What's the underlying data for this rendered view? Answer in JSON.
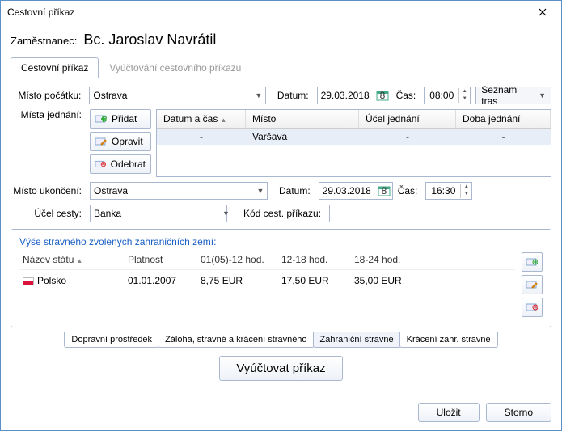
{
  "window": {
    "title": "Cestovní příkaz"
  },
  "employee": {
    "label": "Zaměstnanec:",
    "name": "Bc. Jaroslav Navrátil"
  },
  "tabs": {
    "order": "Cestovní příkaz",
    "billing": "Vyúčtování cestovního příkazu"
  },
  "labels": {
    "start_place": "Místo počátku:",
    "meeting_places": "Místa jednání:",
    "end_place": "Místo ukončení:",
    "purpose": "Účel cesty:",
    "date": "Datum:",
    "time": "Čas:",
    "order_code": "Kód cest. příkazu:",
    "route_list": "Seznam tras"
  },
  "start": {
    "place": "Ostrava",
    "date": "29.03.2018",
    "time": "08:00"
  },
  "end": {
    "place": "Ostrava",
    "date": "29.03.2018",
    "time": "16:30"
  },
  "purpose_value": "Banka",
  "order_code_value": "",
  "action_btns": {
    "add": "Přidat",
    "edit": "Opravit",
    "remove": "Odebrat"
  },
  "grid": {
    "cols": [
      "Datum a čas",
      "Místo",
      "Účel jednání",
      "Doba jednání"
    ],
    "row": {
      "datetime": "-",
      "place": "Varšava",
      "purpose": "-",
      "duration": "-"
    }
  },
  "allowance": {
    "title": "Výše stravného zvolených zahraničních zemí:",
    "cols": [
      "Název státu",
      "Platnost",
      "01(05)-12 hod.",
      "12-18 hod.",
      "18-24 hod."
    ],
    "row": {
      "country": "Polsko",
      "valid_from": "01.01.2007",
      "r1": "8,75 EUR",
      "r2": "17,50 EUR",
      "r3": "35,00 EUR"
    }
  },
  "subtabs": {
    "transport": "Dopravní prostředek",
    "advance": "Záloha, stravné a krácení stravného",
    "foreign": "Zahraniční stravné",
    "reduction": "Krácení zahr. stravné"
  },
  "main_btn": "Vyúčtovat příkaz",
  "footer": {
    "save": "Uložit",
    "cancel": "Storno"
  }
}
